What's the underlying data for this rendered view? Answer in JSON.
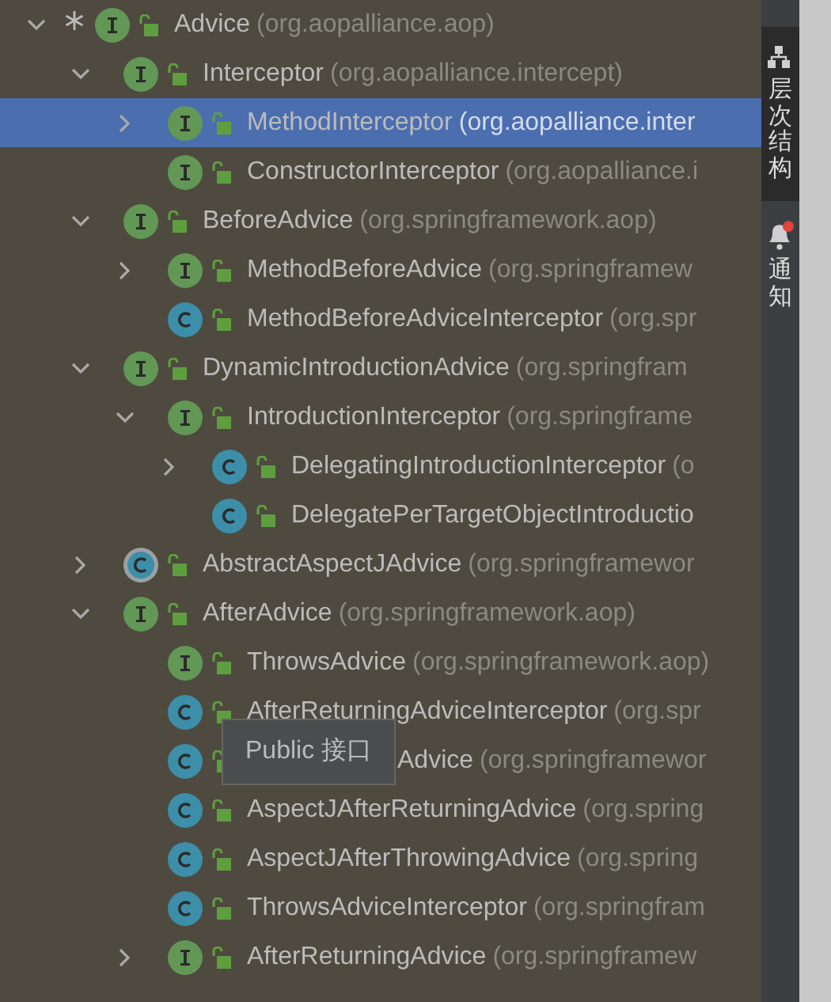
{
  "tree": {
    "name": "Advice",
    "package": "(org.aopalliance.aop)",
    "kind": "interface",
    "starred": true,
    "expanded": true,
    "selected": false,
    "children": [
      {
        "name": "Interceptor",
        "package": "(org.aopalliance.intercept)",
        "kind": "interface",
        "expanded": true,
        "selected": false,
        "children": [
          {
            "name": "MethodInterceptor",
            "package": "(org.aopalliance.inter",
            "kind": "interface",
            "expanded": false,
            "selected": true
          },
          {
            "name": "ConstructorInterceptor",
            "package": "(org.aopalliance.i",
            "kind": "interface",
            "selected": false
          }
        ]
      },
      {
        "name": "BeforeAdvice",
        "package": "(org.springframework.aop)",
        "kind": "interface",
        "expanded": true,
        "selected": false,
        "children": [
          {
            "name": "MethodBeforeAdvice",
            "package": "(org.springframew",
            "kind": "interface",
            "expanded": false,
            "selected": false
          },
          {
            "name": "MethodBeforeAdviceInterceptor",
            "package": "(org.spr",
            "kind": "class",
            "selected": false
          }
        ]
      },
      {
        "name": "DynamicIntroductionAdvice",
        "package": "(org.springfram",
        "kind": "interface",
        "expanded": true,
        "selected": false,
        "children": [
          {
            "name": "IntroductionInterceptor",
            "package": "(org.springframe",
            "kind": "interface",
            "expanded": true,
            "selected": false,
            "children": [
              {
                "name": "DelegatingIntroductionInterceptor",
                "package": "(o",
                "kind": "class",
                "expanded": false,
                "selected": false
              },
              {
                "name": "DelegatePerTargetObjectIntroductio",
                "kind": "class",
                "selected": false
              }
            ]
          }
        ]
      },
      {
        "name": "AbstractAspectJAdvice",
        "package": "(org.springframewor",
        "kind": "abstract_class",
        "expanded": false,
        "selected": false
      },
      {
        "name": "AfterAdvice",
        "package": "(org.springframework.aop)",
        "kind": "interface",
        "expanded": true,
        "selected": false,
        "children": [
          {
            "name": "ThrowsAdvice",
            "package": "(org.springframework.aop)",
            "kind": "interface",
            "selected": false
          },
          {
            "name": "AfterReturningAdviceInterceptor",
            "package": "(org.spr",
            "kind": "class",
            "selected": false
          },
          {
            "name": "Advice",
            "package": "(org.springframewor",
            "kind": "class",
            "selected": false,
            "covered": true
          },
          {
            "name": "AspectJAfterReturningAdvice",
            "package": "(org.spring",
            "kind": "class",
            "selected": false
          },
          {
            "name": "AspectJAfterThrowingAdvice",
            "package": "(org.spring",
            "kind": "class",
            "selected": false
          },
          {
            "name": "ThrowsAdviceInterceptor",
            "package": "(org.springfram",
            "kind": "class",
            "selected": false
          },
          {
            "name": "AfterReturningAdvice",
            "package": "(org.springframew",
            "kind": "interface",
            "expanded": false,
            "selected": false
          }
        ]
      }
    ]
  },
  "tooltip": {
    "text": "Public 接口"
  },
  "sidebar": {
    "tabs": [
      {
        "label": "层次结构",
        "kind": "hierarchy",
        "selected": true,
        "badge": false
      },
      {
        "label": "通知",
        "kind": "bell",
        "selected": false,
        "badge": true
      }
    ]
  }
}
